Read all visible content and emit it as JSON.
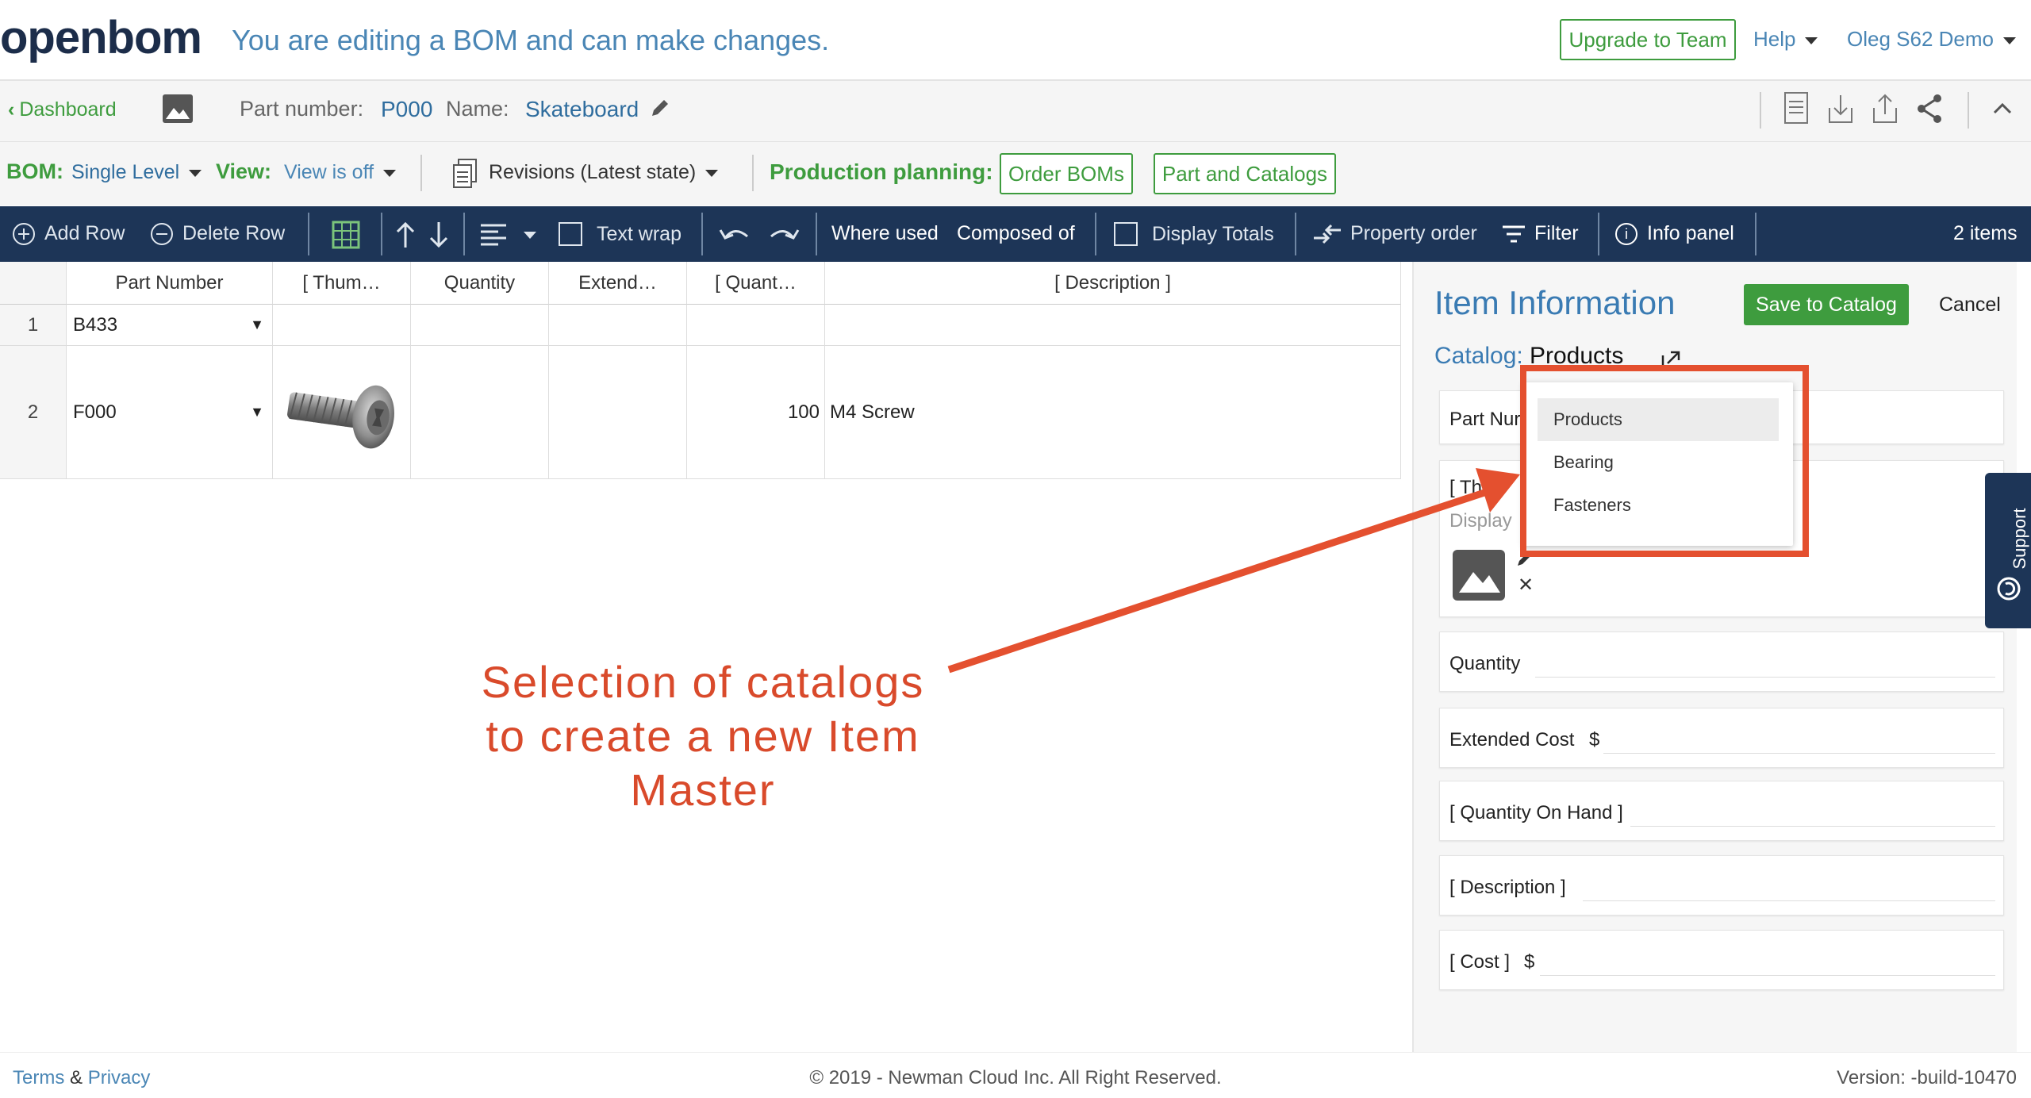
{
  "header": {
    "logo": "openbom",
    "edit_message": "You are editing a BOM and can make changes.",
    "upgrade_label": "Upgrade to Team",
    "help_label": "Help",
    "user_label": "Oleg S62 Demo"
  },
  "partbar": {
    "dashboard_label": "Dashboard",
    "part_number_label": "Part number:",
    "part_number_value": "P000",
    "name_label": "Name:",
    "name_value": "Skateboard"
  },
  "bombar": {
    "bom_label": "BOM:",
    "bom_value": "Single Level",
    "view_label": "View:",
    "view_value": "View is off",
    "revisions_label": "Revisions (Latest state)",
    "production_label": "Production planning:",
    "order_boms_label": "Order BOMs",
    "part_catalogs_label": "Part and Catalogs"
  },
  "toolbar": {
    "add_row": "Add Row",
    "delete_row": "Delete Row",
    "text_wrap": "Text wrap",
    "where_used": "Where used",
    "composed_of": "Composed of",
    "display_totals": "Display Totals",
    "property_order": "Property order",
    "filter": "Filter",
    "info_panel": "Info panel",
    "items_count": "2 items"
  },
  "grid": {
    "headers": [
      "Part Number",
      "[ Thum…",
      "Quantity",
      "Extend…",
      "[ Quant…",
      "[ Description ]"
    ],
    "rows": [
      {
        "num": "1",
        "part_number": "B433",
        "quantity": "",
        "extended": "",
        "qoh": "",
        "description": ""
      },
      {
        "num": "2",
        "part_number": "F000",
        "quantity": "",
        "extended": "",
        "qoh": "100",
        "description": "M4 Screw"
      }
    ]
  },
  "panel": {
    "title": "Item Information",
    "save_label": "Save to Catalog",
    "cancel_label": "Cancel",
    "catalog_label": "Catalog:",
    "catalog_value": "Products",
    "part_number_label": "Part Nur",
    "thumbnail_label": "[ Th",
    "display_label": "Display",
    "quantity_label": "Quantity",
    "extended_cost_label": "Extended Cost",
    "currency": "$",
    "qoh_label": "[ Quantity On Hand ]",
    "description_label": "[ Description ]",
    "cost_label": "[ Cost ]"
  },
  "catalog_dropdown": {
    "options": [
      "Products",
      "Bearing",
      "Fasteners"
    ],
    "selected": "Products"
  },
  "annotation": {
    "line1": "Selection of catalogs",
    "line2": "to create a new Item",
    "line3": "Master",
    "color": "#d94a2b"
  },
  "support_label": "Support",
  "footer": {
    "terms": "Terms",
    "amp": "&",
    "privacy": "Privacy",
    "copyright": "© 2019 - Newman Cloud Inc. All Right Reserved.",
    "version": "Version: -build-10470"
  },
  "colors": {
    "accent_green": "#3e9c3e",
    "link_blue": "#4a86b5",
    "toolbar_navy": "#1d3557",
    "annotation_red": "#e4502f"
  }
}
